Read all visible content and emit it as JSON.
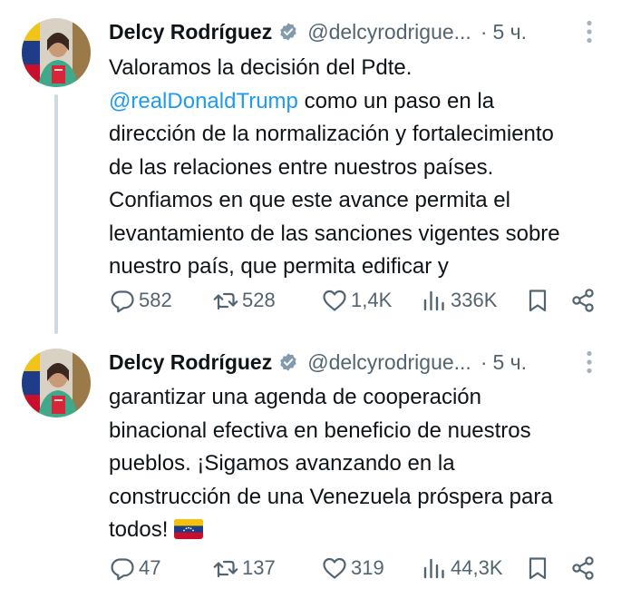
{
  "tweets": [
    {
      "author_name": "Delcy Rodríguez",
      "author_handle": "@delcyrodrigue...",
      "separator": "·",
      "time": "5 ч.",
      "text_lines": [
        "Valoramos la decisión del Pdte.",
        "como un paso en la",
        "dirección de la normalización y fortalecimiento",
        "de las relaciones entre nuestros países.",
        "Confiamos en que este avance permita el",
        "levantamiento de las sanciones vigentes sobre",
        "nuestro país, que permita edificar y"
      ],
      "mention": "@realDonaldTrump",
      "stats": {
        "replies": "582",
        "retweets": "528",
        "likes": "1,4K",
        "views": "336K"
      }
    },
    {
      "author_name": "Delcy Rodríguez",
      "author_handle": "@delcyrodrigue...",
      "separator": "·",
      "time": "5 ч.",
      "text_lines": [
        "garantizar una agenda de cooperación",
        "binacional efectiva en beneficio de nuestros",
        "pueblos. ¡Sigamos avanzando en la",
        "construcción de una Venezuela próspera para",
        "todos!"
      ],
      "emoji": "venezuela-flag-icon",
      "stats": {
        "replies": "47",
        "retweets": "137",
        "likes": "319",
        "views": "44,3K"
      }
    }
  ],
  "colors": {
    "text": "#0f1419",
    "secondary": "#536471",
    "link": "#1d9bf0",
    "thread_line": "#cfd9de",
    "verified_badge": "#829aab"
  }
}
